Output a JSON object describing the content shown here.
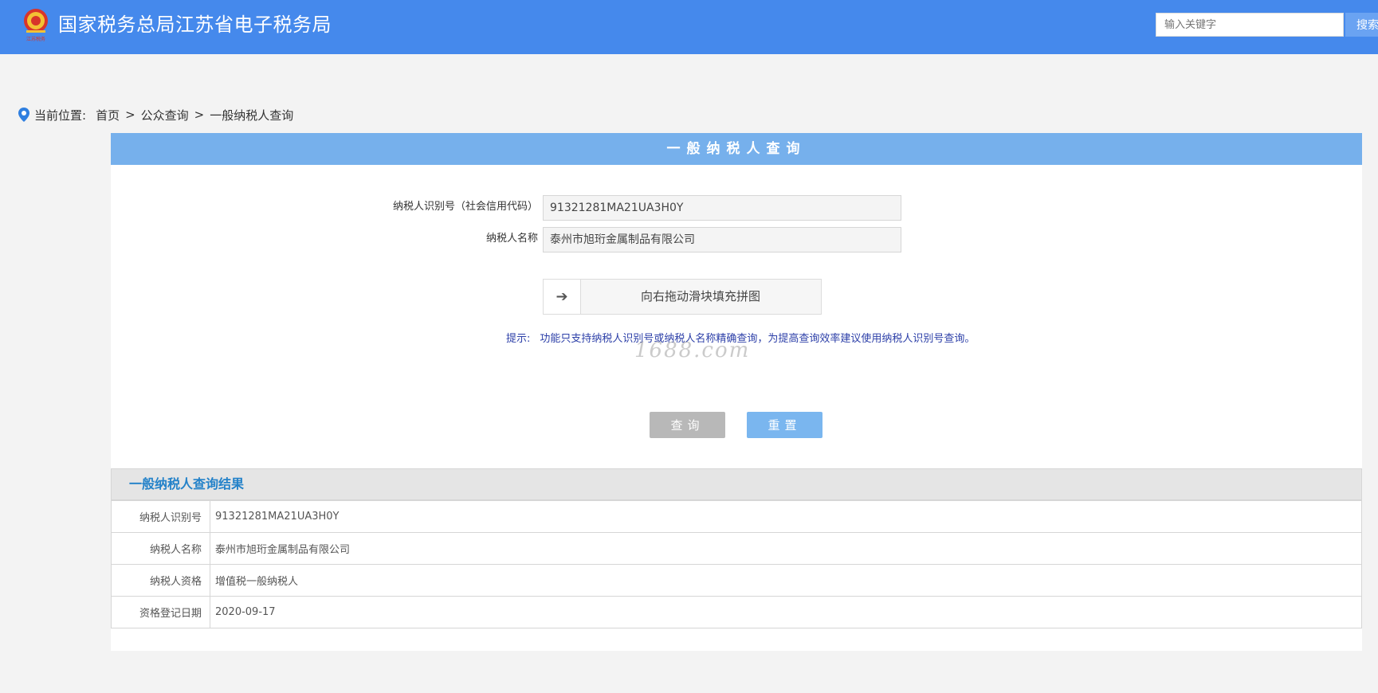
{
  "header": {
    "site_title": "国家税务总局江苏省电子税务局",
    "logo_caption": "江苏税务",
    "search_placeholder": "输入关键字",
    "search_button": "搜索"
  },
  "breadcrumb": {
    "label": "当前位置:",
    "items": [
      "首页",
      "公众查询",
      "一般纳税人查询"
    ],
    "separator": ">"
  },
  "form": {
    "title": "一般纳税人查询",
    "taxpayer_id_label": "纳税人识别号（社会信用代码）",
    "taxpayer_id_value": "91321281MA21UA3H0Y",
    "taxpayer_name_label": "纳税人名称",
    "taxpayer_name_value": "泰州市旭珩金属制品有限公司",
    "slider_text": "向右拖动滑块填充拼图",
    "hint_label": "提示:",
    "hint_text": "功能只支持纳税人识别号或纳税人名称精确查询，为提高查询效率建议使用纳税人识别号查询。",
    "watermark": "1688.com",
    "query_button": "查询",
    "reset_button": "重置"
  },
  "result": {
    "title": "一般纳税人查询结果",
    "rows": [
      {
        "key": "纳税人识别号",
        "value": "91321281MA21UA3H0Y"
      },
      {
        "key": "纳税人名称",
        "value": "泰州市旭珩金属制品有限公司"
      },
      {
        "key": "纳税人资格",
        "value": "增值税一般纳税人"
      },
      {
        "key": "资格登记日期",
        "value": "2020-09-17"
      }
    ]
  },
  "colors": {
    "topbar": "#4589ec",
    "panel_header": "#76b0ec",
    "query_button": "#b8b8b8",
    "reset_button": "#7ab6ef",
    "result_title": "#2482c9",
    "hint": "#2c3fa8"
  }
}
